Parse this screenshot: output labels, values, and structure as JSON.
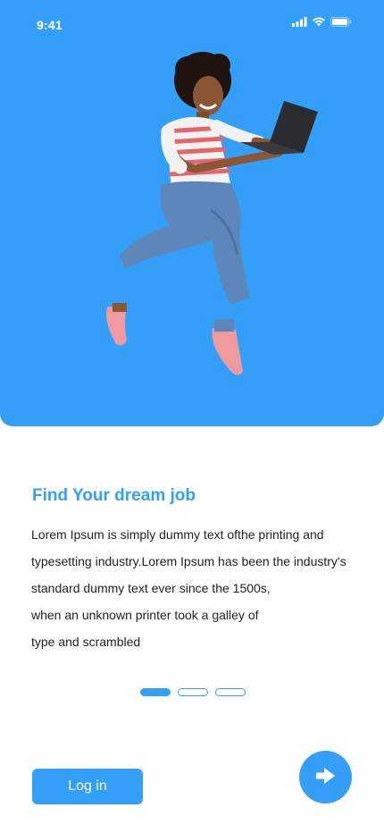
{
  "status_bar": {
    "time": "9:41",
    "icons": [
      "signal-icon",
      "wifi-icon",
      "battery-icon"
    ]
  },
  "hero": {
    "background_color": "#349ff8",
    "illustration": "woman-jumping-with-laptop"
  },
  "onboarding": {
    "title": "Find Your dream job",
    "body_lines": [
      "Lorem Ipsum is simply dummy text ofthe printing and",
      "typesetting industry.Lorem Ipsum has been the industry's",
      "standard dummy text ever since the 1500s,",
      "when an unknown printer took a galley of",
      "type and scrambled"
    ],
    "pager": {
      "total": 3,
      "active_index": 0
    }
  },
  "actions": {
    "login_label": "Log in",
    "next_icon": "arrow-right-icon"
  },
  "colors": {
    "accent": "#349ff8",
    "text": "#222222",
    "background": "#ffffff"
  }
}
